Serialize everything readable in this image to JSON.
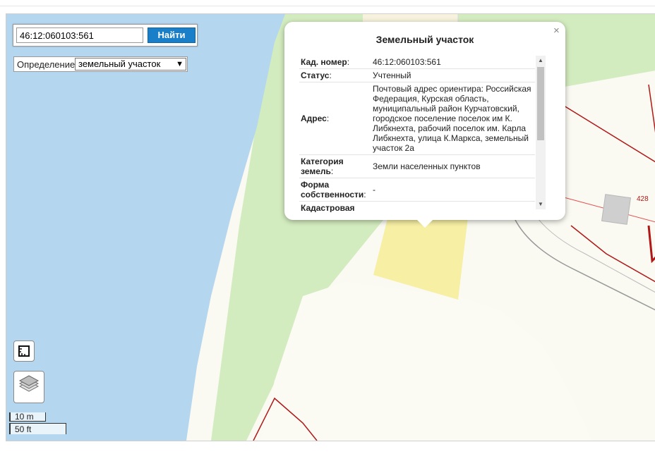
{
  "search": {
    "value": "46:12:060103:561",
    "button_label": "Найти"
  },
  "definition": {
    "label": "Определение:",
    "selected": "земельный участок"
  },
  "popup": {
    "title": "Земельный участок",
    "close": "×",
    "rows": [
      {
        "key": "Кад. номер",
        "value": "46:12:060103:561"
      },
      {
        "key": "Статус",
        "value": "Учтенный"
      },
      {
        "key": "Адрес",
        "value": "Почтовый адрес ориентира: Российская Федерация, Курская область, муниципальный район Курчатовский, городское поселение поселок им К. Либкнехта, рабочий поселок им. Карла Либкнехта, улица К.Маркса, земельный участок 2а"
      },
      {
        "key": "Категория земель",
        "value": "Земли населенных пунктов"
      },
      {
        "key": "Форма собственности",
        "value": "-"
      },
      {
        "key": "Кадастровая",
        "value": ""
      }
    ]
  },
  "scale": {
    "metric": "10 m",
    "imperial": "50 ft"
  },
  "map_labels": {
    "parcel_number": "428"
  },
  "icons": {
    "measure": "ruler-icon",
    "layers": "layers-icon"
  },
  "colors": {
    "water": "#b5d6ef",
    "green": "#d3ecbf",
    "parcel_fill": "#f9f0a6",
    "boundary": "#b01818",
    "button": "#1a7fc9"
  }
}
